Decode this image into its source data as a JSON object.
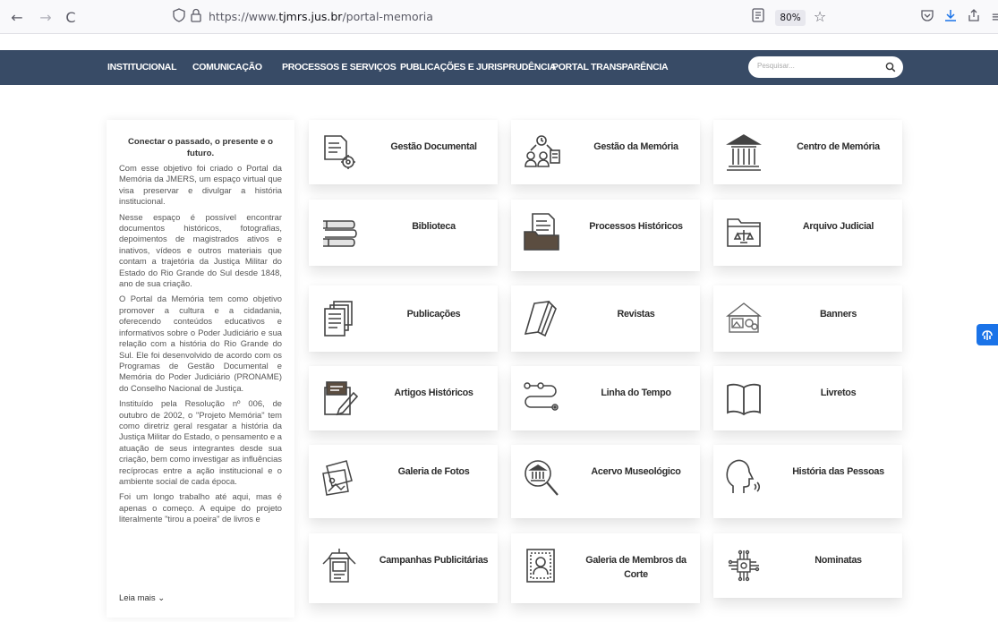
{
  "browser": {
    "back": "←",
    "forward": "→",
    "reload": "C",
    "url_prefix": "https://www.",
    "url_domain": "tjmrs.jus.br",
    "url_path": "/portal-memoria",
    "zoom": "80%"
  },
  "nav": {
    "items": [
      "INSTITUCIONAL",
      "COMUNICAÇÃO",
      "PROCESSOS E SERVIÇOS",
      "PUBLICAÇÕES E JURISPRUDÊNCIA",
      "PORTAL TRANSPARÊNCIA"
    ],
    "search_placeholder": "Pesquisar..."
  },
  "intro": {
    "title": "Conectar o passado, o presente e o futuro.",
    "paragraphs": [
      "Com esse objetivo foi criado o Portal da Memória da JMERS, um espaço virtual que visa preservar e divulgar a história institucional.",
      "Nesse espaço é possível encontrar documentos históricos, fotografias, depoimentos de magistrados ativos e inativos, vídeos e outros materiais que contam a trajetória da Justiça Militar do Estado do Rio Grande do Sul desde 1848, ano de sua criação.",
      "O Portal da Memória tem como objetivo promover a cultura e a cidadania, oferecendo conteúdos educativos e informativos sobre o Poder Judiciário e sua relação com a história do Rio Grande do Sul. Ele foi desenvolvido de acordo com os Programas de Gestão Documental e Memória do Poder Judiciário (PRONAME) do Conselho Nacional de Justiça.",
      "Instituído pela Resolução nº 006, de outubro de 2002, o \"Projeto Memória\" tem como diretriz geral resgatar a história da Justiça Militar do Estado, o pensamento e a atuação de seus integrantes desde sua criação, bem como investigar as influências recíprocas entre a ação institucional e o ambiente social de cada época.",
      "Foi um longo trabalho até aqui, mas é apenas o começo. A equipe do projeto literalmente \"tirou a poeira\" de livros e"
    ],
    "read_more": "Leia mais ⌄"
  },
  "tiles": [
    {
      "label": "Gestão Documental",
      "icon": "document-gear-icon"
    },
    {
      "label": "Gestão da Memória",
      "icon": "people-memory-icon"
    },
    {
      "label": "Centro de Memória",
      "icon": "institution-building-icon"
    },
    {
      "label": "Biblioteca",
      "icon": "books-stack-icon"
    },
    {
      "label": "Processos Históricos",
      "icon": "folder-documents-icon"
    },
    {
      "label": "Arquivo Judicial",
      "icon": "folder-scales-icon"
    },
    {
      "label": "Publicações",
      "icon": "publications-stack-icon"
    },
    {
      "label": "Revistas",
      "icon": "magazines-icon"
    },
    {
      "label": "Banners",
      "icon": "banner-picture-icon"
    },
    {
      "label": "Artigos Históricos",
      "icon": "article-pen-icon"
    },
    {
      "label": "Linha do Tempo",
      "icon": "timeline-icon"
    },
    {
      "label": "Livretos",
      "icon": "open-book-icon"
    },
    {
      "label": "Galeria de Fotos",
      "icon": "photo-gallery-icon"
    },
    {
      "label": "Acervo Museológico",
      "icon": "museum-magnifier-icon"
    },
    {
      "label": "História das Pessoas",
      "icon": "speaking-head-icon"
    },
    {
      "label": "Campanhas Publicitárias",
      "icon": "campaign-poster-icon"
    },
    {
      "label": "Galeria de Membros da Corte",
      "icon": "member-portrait-icon"
    },
    {
      "label": "Nominatas",
      "icon": "network-chip-icon"
    }
  ]
}
